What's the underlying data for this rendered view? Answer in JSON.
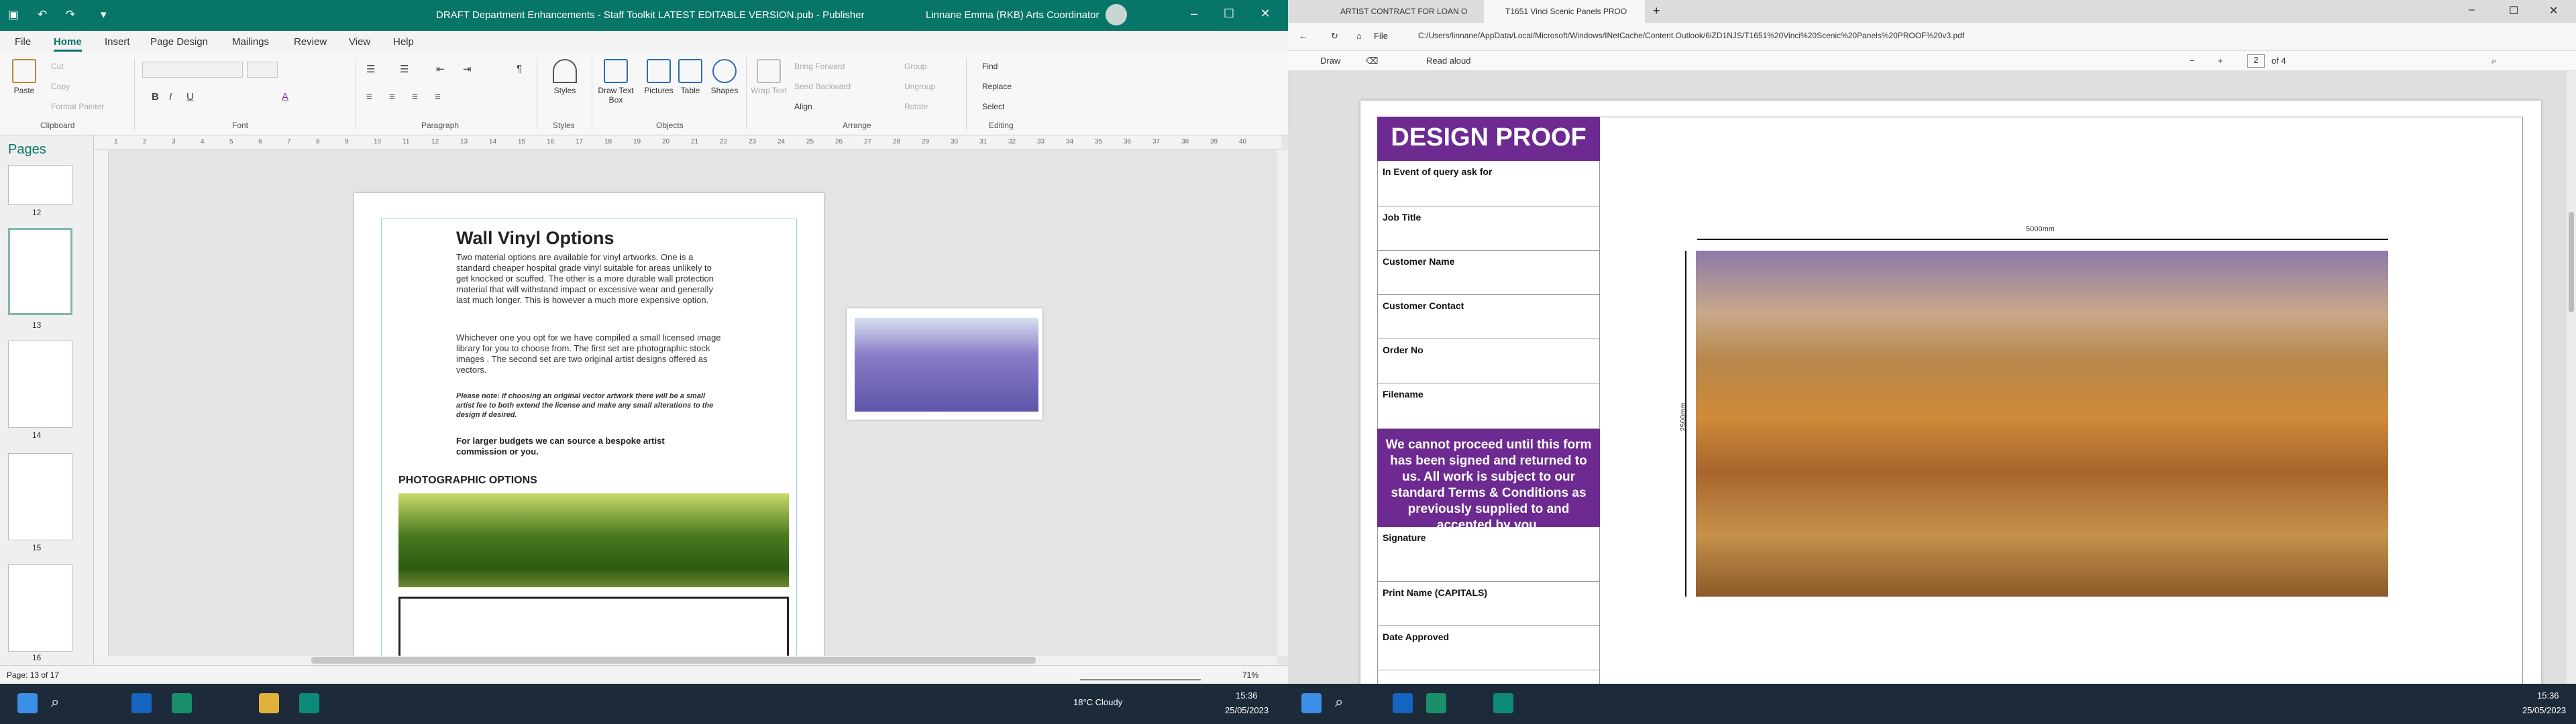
{
  "publisher": {
    "title": "DRAFT Department Enhancements - Staff Toolkit LATEST EDITABLE VERSION.pub  -  Publisher",
    "user": "Linnane Emma (RKB) Arts Coordinator",
    "tabs": [
      "File",
      "Home",
      "Insert",
      "Page Design",
      "Mailings",
      "Review",
      "View",
      "Help"
    ],
    "ribbon": {
      "clipboard": {
        "paste": "Paste",
        "cut": "Cut",
        "copy": "Copy",
        "format_painter": "Format Painter",
        "label": "Clipboard"
      },
      "font_label": "Font",
      "paragraph_label": "Paragraph",
      "styles": {
        "button": "Styles",
        "label": "Styles"
      },
      "objects": {
        "draw_text_box": "Draw Text Box",
        "pictures": "Pictures",
        "table": "Table",
        "shapes": "Shapes",
        "label": "Objects"
      },
      "arrange": {
        "wrap_text": "Wrap Text",
        "bring_forward": "Bring Forward",
        "send_backward": "Send Backward",
        "group": "Group",
        "ungroup": "Ungroup",
        "rotate": "Rotate",
        "align": "Align",
        "label": "Arrange"
      },
      "editing": {
        "find": "Find",
        "replace": "Replace",
        "select": "Select",
        "label": "Editing"
      }
    },
    "pages_panel": {
      "title": "Pages",
      "numbers": [
        "12",
        "13",
        "14",
        "15",
        "16"
      ]
    },
    "ruler_nums": [
      "1",
      "2",
      "3",
      "4",
      "5",
      "6",
      "7",
      "8",
      "9",
      "10",
      "11",
      "12",
      "13",
      "14",
      "15",
      "16",
      "17",
      "18",
      "19",
      "20",
      "21",
      "22",
      "23",
      "24",
      "25",
      "26",
      "27",
      "28",
      "29",
      "30",
      "31",
      "32",
      "33",
      "34",
      "35",
      "36",
      "37",
      "38",
      "39",
      "40"
    ],
    "doc": {
      "heading": "Wall Vinyl Options",
      "para1": "Two material options are available for vinyl artworks. One is a standard  cheaper hospital grade vinyl suitable for areas unlikely to get knocked or scuffed. The other is a more durable wall protection material that will withstand impact or excessive wear and generally last much longer. This is however a much more expensive option.",
      "para2": "Whichever one you opt for we have compiled a small licensed image library for you to choose from. The first set are photographic stock images . The second set are two original artist designs offered as vectors.",
      "note": "Please note: if choosing an original vector artwork there will be a small artist fee to both extend the license and make any small alterations to the design if desired.",
      "bold": "For larger budgets we can source a bespoke artist commission or you.",
      "section": "PHOTOGRAPHIC OPTIONS",
      "photo_color": "#4a7a1e",
      "side_image_color": "#7a6fb8"
    },
    "status": {
      "page": "Page: 13 of 17",
      "zoom": "71%"
    }
  },
  "pdf": {
    "tabs": [
      "ARTIST CONTRACT FOR LOAN O",
      "T1651 Vinci Scenic Panels PROO"
    ],
    "address_prefix": "File",
    "url": "C:/Users/linnane/AppData/Local/Microsoft/Windows/INetCache/Content.Outlook/6iZD1NJS/T1651%20Vinci%20Scenic%20Panels%20PROOF%20v3.pdf",
    "toolbar": {
      "draw": "Draw",
      "read_aloud": "Read aloud",
      "page": "2",
      "of": "of 4"
    },
    "proof": {
      "header": "DESIGN PROOF",
      "rows": [
        "In Event of query ask for",
        "Job Title",
        "Customer Name",
        "Customer Contact",
        "Order No",
        "Filename"
      ],
      "notice": "We cannot proceed until this form has been signed and returned to us. All work is subject to our standard Terms & Conditions as previously supplied to and accepted by you.",
      "rows2": [
        "Signature",
        "Print Name (CAPITALS)",
        "Date Approved"
      ],
      "width_dim": "5000mm",
      "height_dim": "2500mm"
    }
  },
  "taskbar_left": {
    "weather": "18°C  Cloudy",
    "time": "15:36",
    "date": "25/05/2023"
  },
  "taskbar_right": {
    "time": "15:36",
    "date": "25/05/2023"
  }
}
